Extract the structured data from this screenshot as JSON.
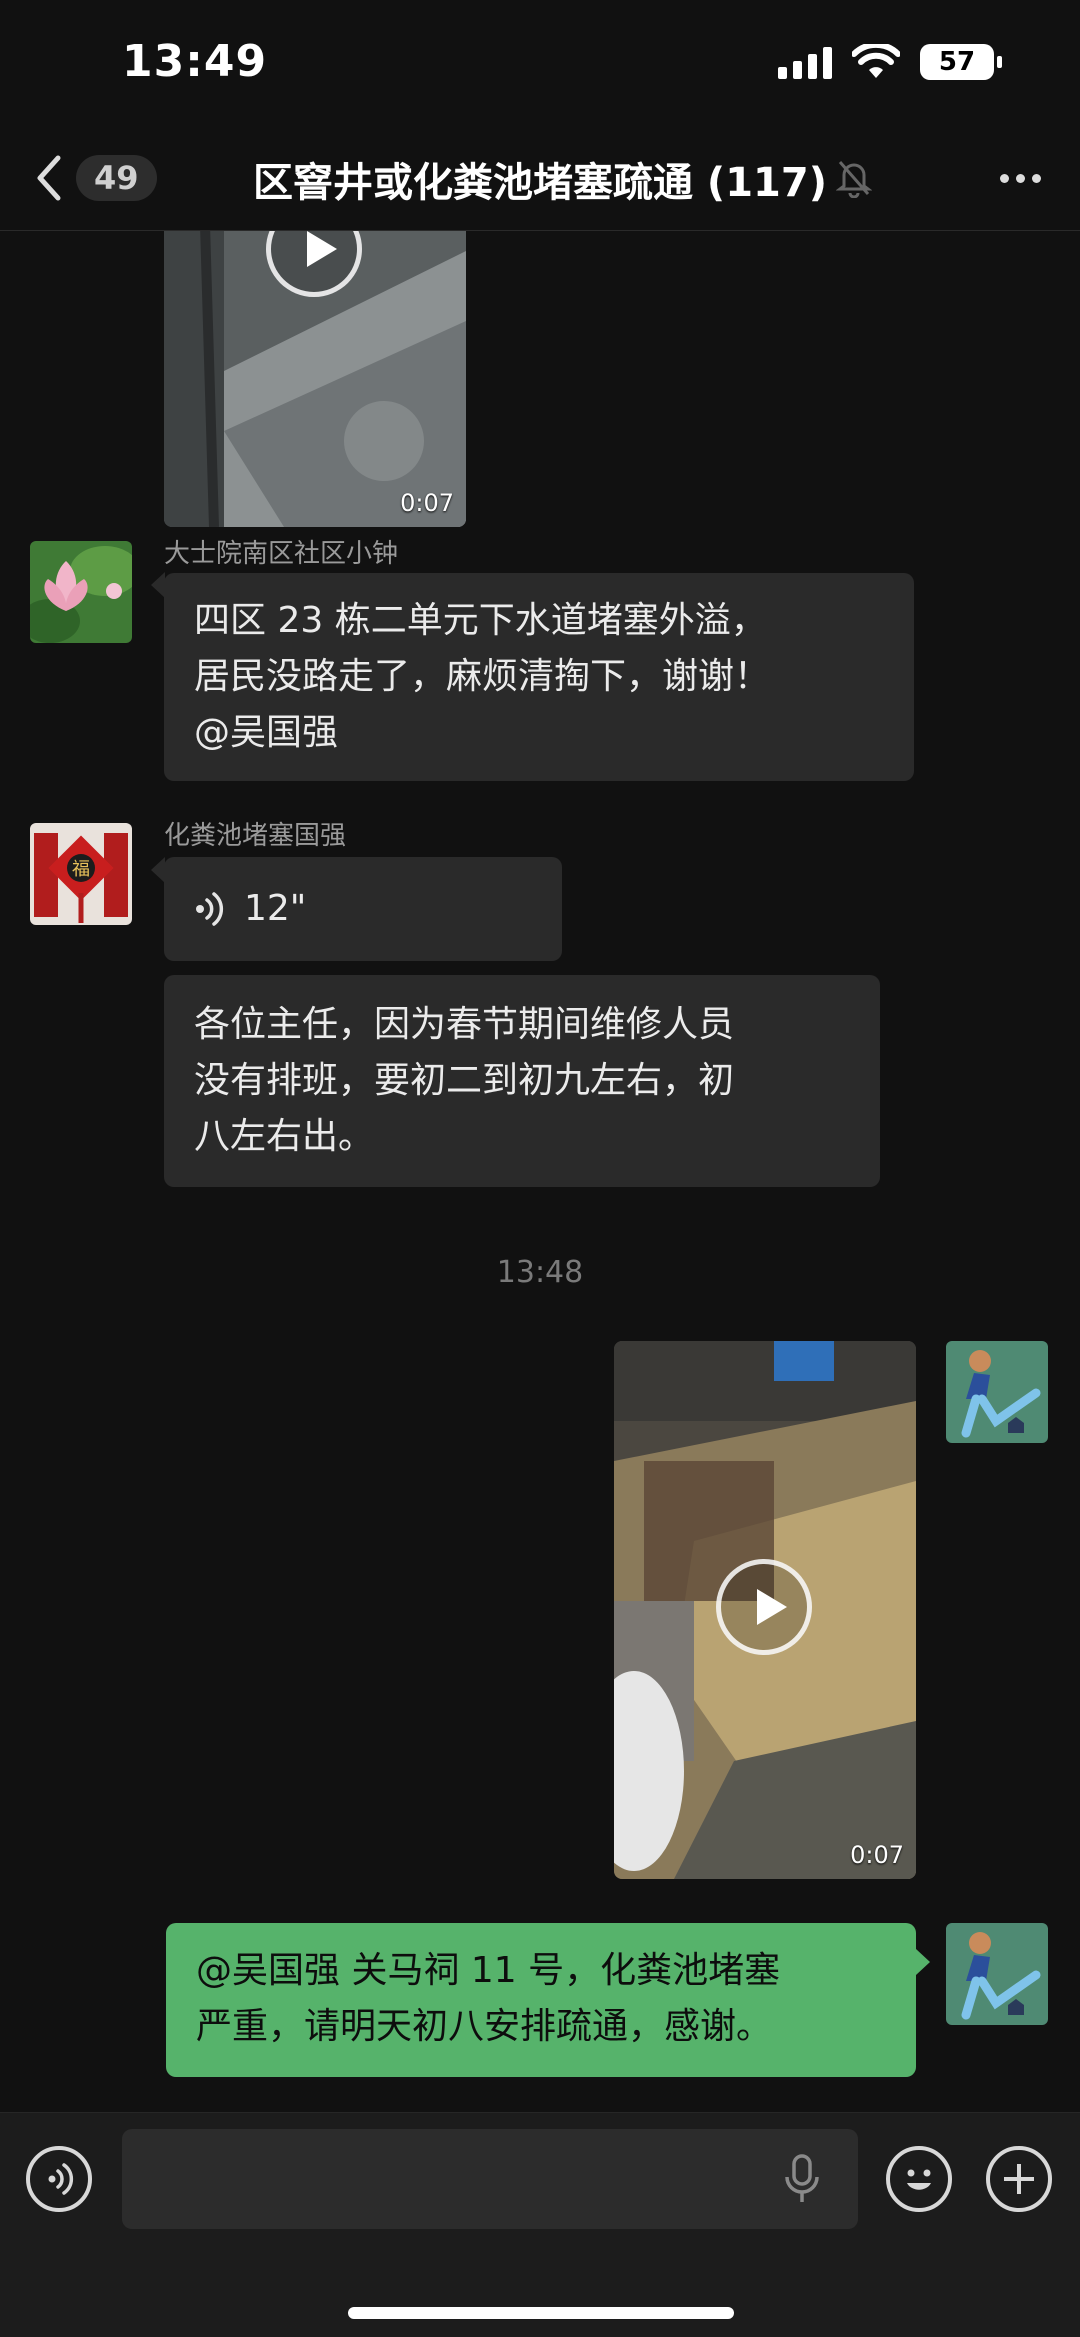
{
  "status_bar": {
    "time": "13:49",
    "battery": "57"
  },
  "nav": {
    "unread_count": "49",
    "title": "区窨井或化粪池堵塞疏通 (117)"
  },
  "messages": {
    "video1_duration": "0:07",
    "msg1": {
      "sender": "大士院南区社区小钟",
      "lines": [
        "四区 23 栋二单元下水道堵塞外溢，",
        "居民没路走了，麻烦清掏下，谢谢！",
        "@吴国强"
      ]
    },
    "msg2": {
      "sender": "化粪池堵塞国强",
      "voice_duration": "12\"",
      "lines": [
        "各位主任，因为春节期间维修人员",
        "没有排班，要初二到初九左右，初",
        "八左右出。"
      ]
    },
    "timestamp": "13:48",
    "video2_duration": "0:07",
    "msg3": {
      "lines": [
        "@吴国强 关马祠 11 号，化粪池堵塞",
        "严重，请明天初八安排疏通，感谢。"
      ]
    }
  },
  "colors": {
    "background": "#111111",
    "bubble_other": "#2a2a2a",
    "bubble_self": "#56b36b"
  },
  "icons": [
    "back-chevron-icon",
    "mute-bell-icon",
    "more-dots-icon",
    "play-icon",
    "voice-wave-icon",
    "microphone-icon",
    "emoji-icon",
    "plus-icon"
  ]
}
